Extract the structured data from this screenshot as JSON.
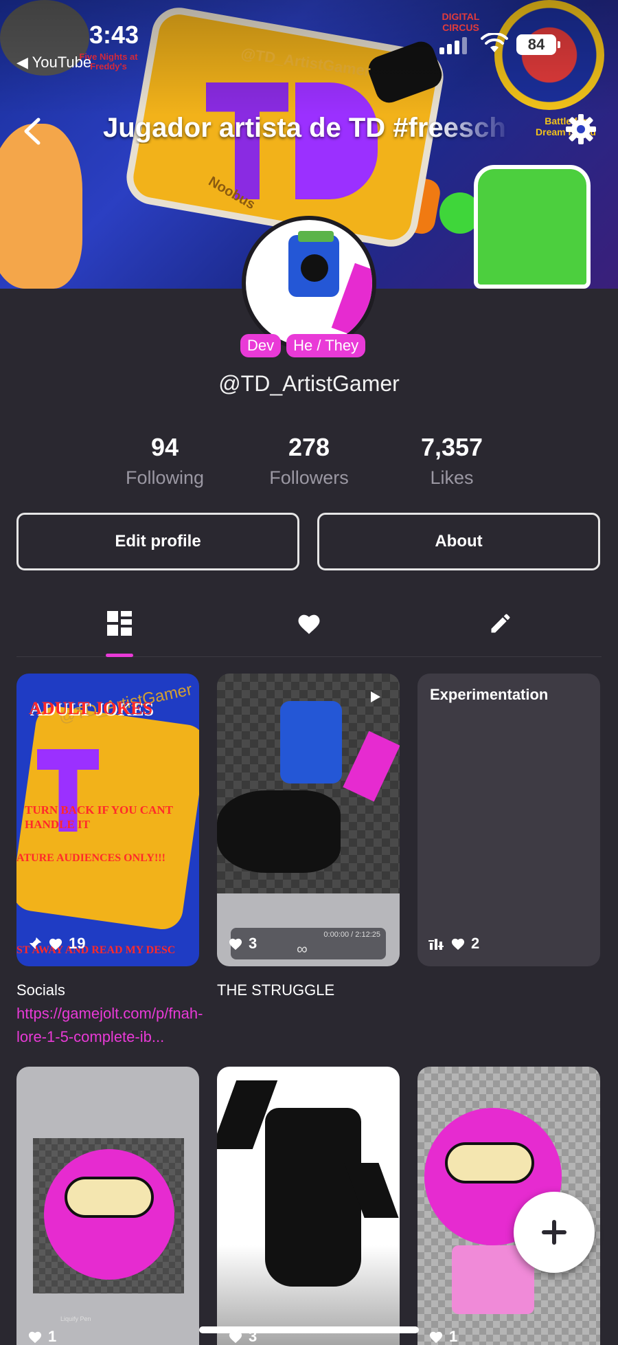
{
  "status_bar": {
    "time": "3:43",
    "back_app": "◀ YouTube",
    "battery": "84"
  },
  "header": {
    "title": "Jugador artista de TD #freesch",
    "banner_text": [
      "@TD_ArtistGamer",
      "Noobus",
      "Five Nights at Freddy's",
      "Battle for Dream Island",
      "DIGITAL CIRCUS"
    ]
  },
  "profile": {
    "tags": [
      "Dev",
      "He / They"
    ],
    "username": "@TD_ArtistGamer",
    "stats": [
      {
        "value": "94",
        "label": "Following"
      },
      {
        "value": "278",
        "label": "Followers"
      },
      {
        "value": "7,357",
        "label": "Likes"
      }
    ],
    "buttons": {
      "edit": "Edit profile",
      "about": "About"
    }
  },
  "tabs": [
    {
      "name": "posts",
      "icon": "grid-icon",
      "active": true
    },
    {
      "name": "likes",
      "icon": "heart-icon",
      "active": false
    },
    {
      "name": "drafts",
      "icon": "pencil-icon",
      "active": false
    }
  ],
  "posts": [
    {
      "image_text": {
        "title": "ADULT JOKES",
        "warning": "TURN BACK IF YOU CANT HANDLE IT",
        "audience": "ATURE AUDIENCES ONLY!!!",
        "footer": "ST AWAY AND READ MY DESC",
        "watermark": "@TD_ArtistGamer"
      },
      "likes": "19",
      "caption": "Socials ",
      "link": "https://gamejolt.com/p/fnah-lore-1-5-complete-ib..."
    },
    {
      "likes": "3",
      "caption": "THE STRUGGLE",
      "video_time": "0:00:00 / 2:12:25",
      "video_controls": "∞"
    },
    {
      "title": "Experimentation",
      "likes": "2"
    },
    {
      "likes": "1",
      "tool_label": "Liquify Pen"
    },
    {
      "likes": "3"
    },
    {
      "likes": "1"
    }
  ],
  "colors": {
    "accent": "#e93ad7",
    "background": "#2a2830",
    "card": "#3e3b44"
  }
}
